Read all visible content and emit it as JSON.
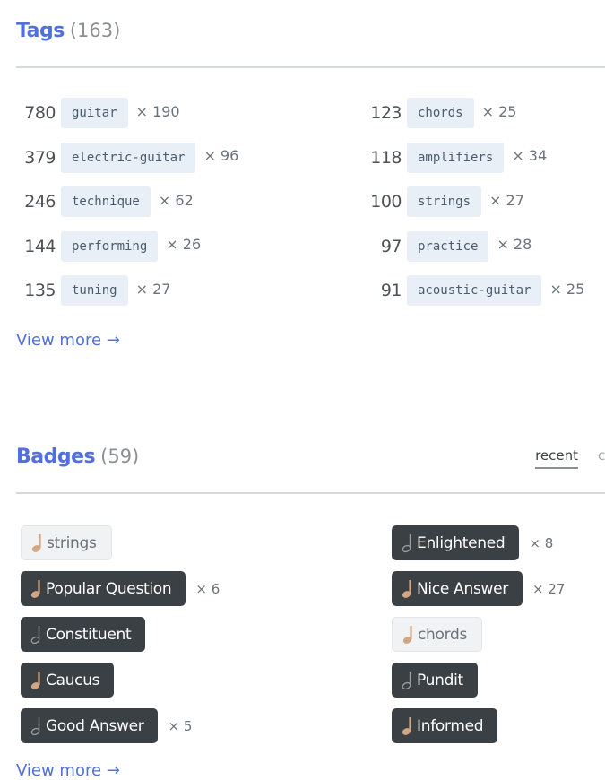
{
  "tags": {
    "title": "Tags",
    "count": "(163)",
    "columns": [
      [
        {
          "score": "780",
          "name": "guitar",
          "posts": "× 190"
        },
        {
          "score": "379",
          "name": "electric-guitar",
          "posts": "× 96"
        },
        {
          "score": "246",
          "name": "technique",
          "posts": "× 62"
        },
        {
          "score": "144",
          "name": "performing",
          "posts": "× 26"
        },
        {
          "score": "135",
          "name": "tuning",
          "posts": "× 27"
        }
      ],
      [
        {
          "score": "123",
          "name": "chords",
          "posts": "× 25"
        },
        {
          "score": "118",
          "name": "amplifiers",
          "posts": "× 34"
        },
        {
          "score": "100",
          "name": "strings",
          "posts": "× 27"
        },
        {
          "score": "97",
          "name": "practice",
          "posts": "× 28"
        },
        {
          "score": "91",
          "name": "acoustic-guitar",
          "posts": "× 25"
        }
      ]
    ],
    "view_more": "View more →"
  },
  "badges": {
    "title": "Badges",
    "count": "(59)",
    "tabs": {
      "active": "recent",
      "next": "c"
    },
    "columns": [
      [
        {
          "name": "strings",
          "tier": "bronze",
          "style": "tag",
          "times": ""
        },
        {
          "name": "Popular Question",
          "tier": "bronze",
          "style": "badge",
          "times": "× 6"
        },
        {
          "name": "Constituent",
          "tier": "silver",
          "style": "badge",
          "times": ""
        },
        {
          "name": "Caucus",
          "tier": "bronze",
          "style": "badge",
          "times": ""
        },
        {
          "name": "Good Answer",
          "tier": "silver",
          "style": "badge",
          "times": "× 5"
        }
      ],
      [
        {
          "name": "Enlightened",
          "tier": "silver",
          "style": "badge",
          "times": "× 8"
        },
        {
          "name": "Nice Answer",
          "tier": "bronze",
          "style": "badge",
          "times": "× 27"
        },
        {
          "name": "chords",
          "tier": "bronze",
          "style": "tag",
          "times": ""
        },
        {
          "name": "Pundit",
          "tier": "silver",
          "style": "badge",
          "times": ""
        },
        {
          "name": "Informed",
          "tier": "bronze",
          "style": "badge",
          "times": ""
        }
      ]
    ],
    "view_more": "View more →"
  },
  "colors": {
    "accent": "#5170de",
    "bronze": "#d1a684",
    "silver": "#9a9c9f",
    "badge_dark": "#3b4045",
    "tag_bg": "#e8eff7"
  }
}
